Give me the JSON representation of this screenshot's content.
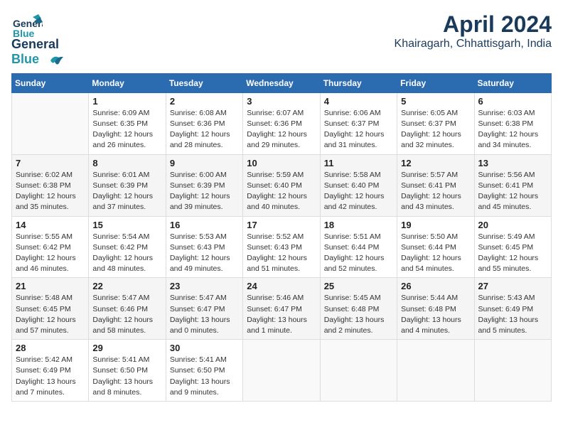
{
  "header": {
    "logo_line1": "General",
    "logo_line2": "Blue",
    "title": "April 2024",
    "subtitle": "Khairagarh, Chhattisgarh, India"
  },
  "weekdays": [
    "Sunday",
    "Monday",
    "Tuesday",
    "Wednesday",
    "Thursday",
    "Friday",
    "Saturday"
  ],
  "weeks": [
    [
      {
        "day": "",
        "info": ""
      },
      {
        "day": "1",
        "info": "Sunrise: 6:09 AM\nSunset: 6:35 PM\nDaylight: 12 hours\nand 26 minutes."
      },
      {
        "day": "2",
        "info": "Sunrise: 6:08 AM\nSunset: 6:36 PM\nDaylight: 12 hours\nand 28 minutes."
      },
      {
        "day": "3",
        "info": "Sunrise: 6:07 AM\nSunset: 6:36 PM\nDaylight: 12 hours\nand 29 minutes."
      },
      {
        "day": "4",
        "info": "Sunrise: 6:06 AM\nSunset: 6:37 PM\nDaylight: 12 hours\nand 31 minutes."
      },
      {
        "day": "5",
        "info": "Sunrise: 6:05 AM\nSunset: 6:37 PM\nDaylight: 12 hours\nand 32 minutes."
      },
      {
        "day": "6",
        "info": "Sunrise: 6:03 AM\nSunset: 6:38 PM\nDaylight: 12 hours\nand 34 minutes."
      }
    ],
    [
      {
        "day": "7",
        "info": "Sunrise: 6:02 AM\nSunset: 6:38 PM\nDaylight: 12 hours\nand 35 minutes."
      },
      {
        "day": "8",
        "info": "Sunrise: 6:01 AM\nSunset: 6:39 PM\nDaylight: 12 hours\nand 37 minutes."
      },
      {
        "day": "9",
        "info": "Sunrise: 6:00 AM\nSunset: 6:39 PM\nDaylight: 12 hours\nand 39 minutes."
      },
      {
        "day": "10",
        "info": "Sunrise: 5:59 AM\nSunset: 6:40 PM\nDaylight: 12 hours\nand 40 minutes."
      },
      {
        "day": "11",
        "info": "Sunrise: 5:58 AM\nSunset: 6:40 PM\nDaylight: 12 hours\nand 42 minutes."
      },
      {
        "day": "12",
        "info": "Sunrise: 5:57 AM\nSunset: 6:41 PM\nDaylight: 12 hours\nand 43 minutes."
      },
      {
        "day": "13",
        "info": "Sunrise: 5:56 AM\nSunset: 6:41 PM\nDaylight: 12 hours\nand 45 minutes."
      }
    ],
    [
      {
        "day": "14",
        "info": "Sunrise: 5:55 AM\nSunset: 6:42 PM\nDaylight: 12 hours\nand 46 minutes."
      },
      {
        "day": "15",
        "info": "Sunrise: 5:54 AM\nSunset: 6:42 PM\nDaylight: 12 hours\nand 48 minutes."
      },
      {
        "day": "16",
        "info": "Sunrise: 5:53 AM\nSunset: 6:43 PM\nDaylight: 12 hours\nand 49 minutes."
      },
      {
        "day": "17",
        "info": "Sunrise: 5:52 AM\nSunset: 6:43 PM\nDaylight: 12 hours\nand 51 minutes."
      },
      {
        "day": "18",
        "info": "Sunrise: 5:51 AM\nSunset: 6:44 PM\nDaylight: 12 hours\nand 52 minutes."
      },
      {
        "day": "19",
        "info": "Sunrise: 5:50 AM\nSunset: 6:44 PM\nDaylight: 12 hours\nand 54 minutes."
      },
      {
        "day": "20",
        "info": "Sunrise: 5:49 AM\nSunset: 6:45 PM\nDaylight: 12 hours\nand 55 minutes."
      }
    ],
    [
      {
        "day": "21",
        "info": "Sunrise: 5:48 AM\nSunset: 6:45 PM\nDaylight: 12 hours\nand 57 minutes."
      },
      {
        "day": "22",
        "info": "Sunrise: 5:47 AM\nSunset: 6:46 PM\nDaylight: 12 hours\nand 58 minutes."
      },
      {
        "day": "23",
        "info": "Sunrise: 5:47 AM\nSunset: 6:47 PM\nDaylight: 13 hours\nand 0 minutes."
      },
      {
        "day": "24",
        "info": "Sunrise: 5:46 AM\nSunset: 6:47 PM\nDaylight: 13 hours\nand 1 minute."
      },
      {
        "day": "25",
        "info": "Sunrise: 5:45 AM\nSunset: 6:48 PM\nDaylight: 13 hours\nand 2 minutes."
      },
      {
        "day": "26",
        "info": "Sunrise: 5:44 AM\nSunset: 6:48 PM\nDaylight: 13 hours\nand 4 minutes."
      },
      {
        "day": "27",
        "info": "Sunrise: 5:43 AM\nSunset: 6:49 PM\nDaylight: 13 hours\nand 5 minutes."
      }
    ],
    [
      {
        "day": "28",
        "info": "Sunrise: 5:42 AM\nSunset: 6:49 PM\nDaylight: 13 hours\nand 7 minutes."
      },
      {
        "day": "29",
        "info": "Sunrise: 5:41 AM\nSunset: 6:50 PM\nDaylight: 13 hours\nand 8 minutes."
      },
      {
        "day": "30",
        "info": "Sunrise: 5:41 AM\nSunset: 6:50 PM\nDaylight: 13 hours\nand 9 minutes."
      },
      {
        "day": "",
        "info": ""
      },
      {
        "day": "",
        "info": ""
      },
      {
        "day": "",
        "info": ""
      },
      {
        "day": "",
        "info": ""
      }
    ]
  ]
}
